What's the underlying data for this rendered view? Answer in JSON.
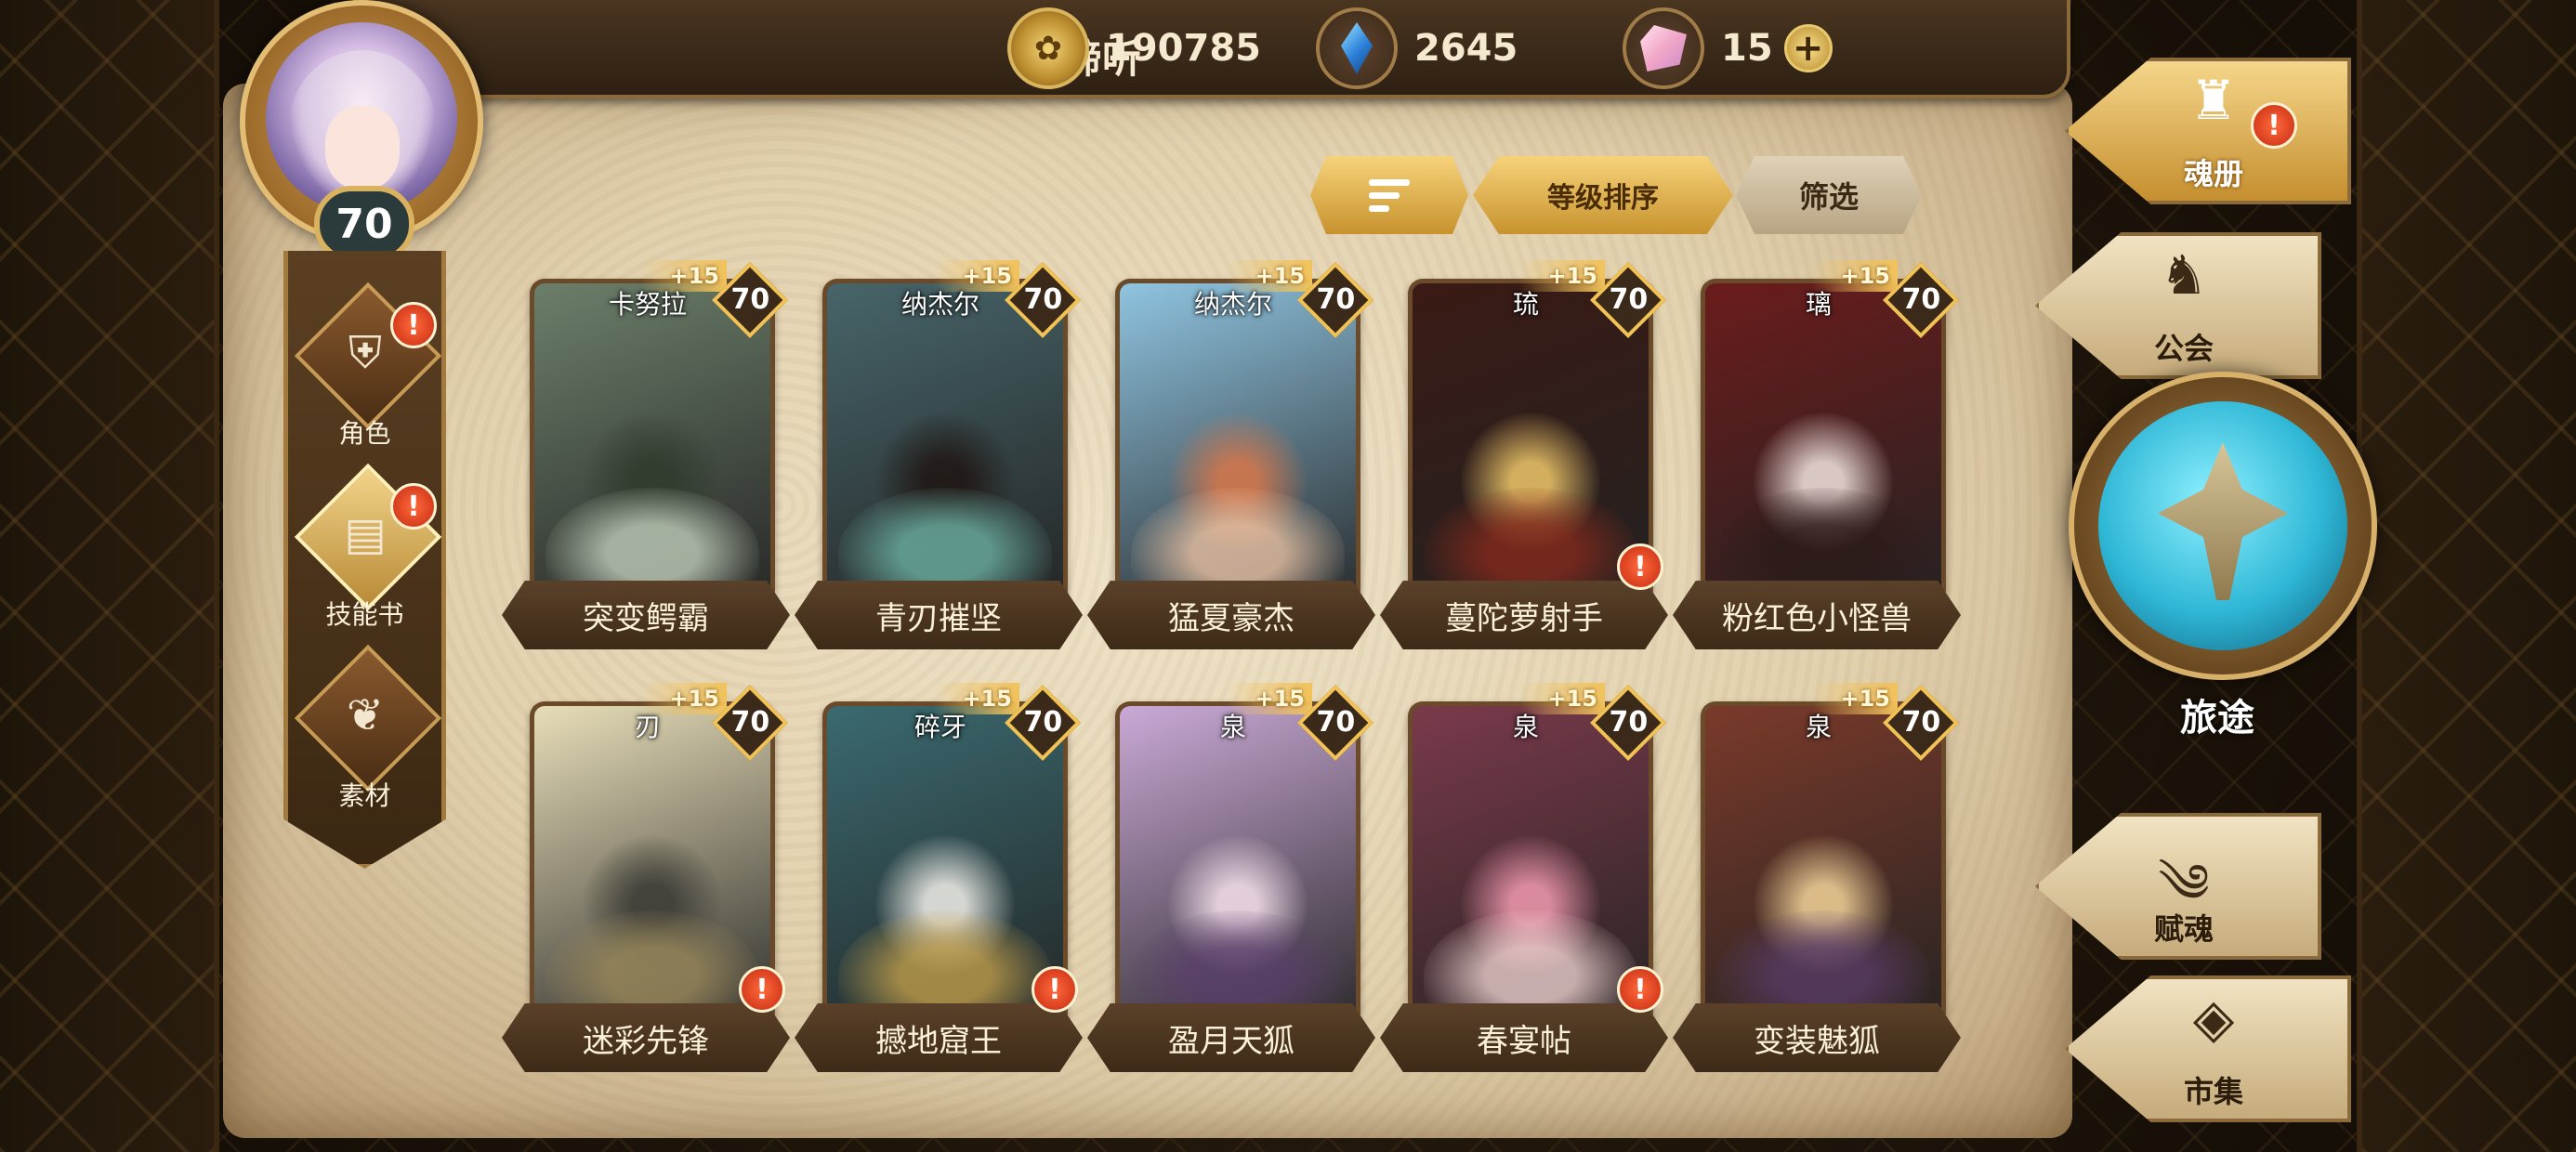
{
  "header": {
    "player_name": "谛听",
    "level": "70",
    "currencies": [
      {
        "icon": "gold-coin-icon",
        "value": "190785"
      },
      {
        "icon": "blue-crystal-icon",
        "value": "2645"
      },
      {
        "icon": "pink-shard-icon",
        "value": "15"
      }
    ],
    "add_symbol": "+"
  },
  "left_nav": [
    {
      "label": "角色",
      "icon": "helmet-icon",
      "alert": "!"
    },
    {
      "label": "技能书",
      "icon": "skill-book-icon",
      "alert": "!"
    },
    {
      "label": "素材",
      "icon": "material-icon"
    }
  ],
  "toolbar": {
    "sort_label": "等级排序",
    "filter_label": "筛选"
  },
  "cards": [
    {
      "sub": "卡努拉",
      "name": "突变鳄霸",
      "level": "70",
      "stars": "+15",
      "alert": false,
      "colors": [
        "#6c7f6a",
        "#2f3a2c",
        "#c9d6c2"
      ]
    },
    {
      "sub": "纳杰尔",
      "name": "青刃摧坚",
      "level": "70",
      "stars": "+15",
      "alert": false,
      "colors": [
        "#47656a",
        "#1f1512",
        "#6fb7a8"
      ]
    },
    {
      "sub": "纳杰尔",
      "name": "猛夏豪杰",
      "level": "70",
      "stars": "+15",
      "alert": false,
      "colors": [
        "#8fc4e0",
        "#d9784a",
        "#f4c9a8"
      ]
    },
    {
      "sub": "琉",
      "name": "蔓陀萝射手",
      "level": "70",
      "stars": "+15",
      "alert": true,
      "colors": [
        "#3a1a14",
        "#f0c86a",
        "#8a2a1c"
      ]
    },
    {
      "sub": "璃",
      "name": "粉红色小怪兽",
      "level": "70",
      "stars": "+15",
      "alert": false,
      "colors": [
        "#6b1c1c",
        "#f3e5e0",
        "#2a1a18"
      ]
    },
    {
      "sub": "刃",
      "name": "迷彩先锋",
      "level": "70",
      "stars": "+15",
      "alert": true,
      "colors": [
        "#e7ddb8",
        "#3a3a34",
        "#9c8a5a"
      ]
    },
    {
      "sub": "碎牙",
      "name": "撼地窟王",
      "level": "70",
      "stars": "+15",
      "alert": true,
      "colors": [
        "#3a6a70",
        "#f2f0ea",
        "#c9a44c"
      ]
    },
    {
      "sub": "泉",
      "name": "盈月天狐",
      "level": "70",
      "stars": "+15",
      "alert": false,
      "colors": [
        "#caa9d6",
        "#f6e2ec",
        "#5a3e6c"
      ]
    },
    {
      "sub": "泉",
      "name": "春宴帖",
      "level": "70",
      "stars": "+15",
      "alert": true,
      "colors": [
        "#7a3a4a",
        "#f29ab0",
        "#f6d8d6"
      ]
    },
    {
      "sub": "泉",
      "name": "变装魅狐",
      "level": "70",
      "stars": "+15",
      "alert": false,
      "colors": [
        "#7a3a2a",
        "#f3d49a",
        "#5a3c6a"
      ]
    }
  ],
  "right_nav": [
    {
      "label": "魂册",
      "icon": "soul-book-icon",
      "active": true,
      "alert": "!"
    },
    {
      "label": "公会",
      "icon": "guild-wolf-icon",
      "active": false
    },
    {
      "label": "旅途",
      "icon": "journey-emblem-icon"
    },
    {
      "label": "赋魂",
      "icon": "flame-swirl-icon",
      "active": false
    },
    {
      "label": "市集",
      "icon": "market-gem-icon",
      "active": false
    }
  ]
}
